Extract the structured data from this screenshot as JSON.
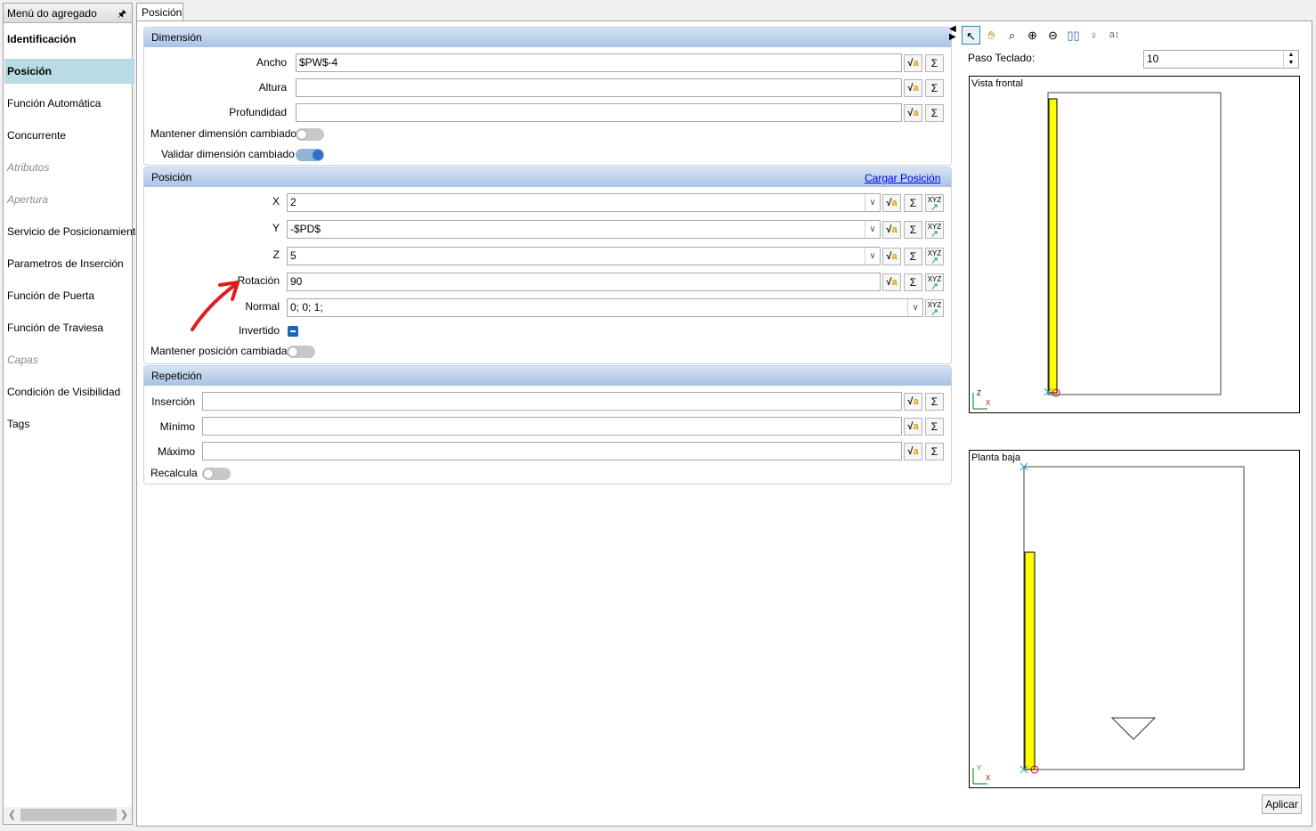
{
  "menu": {
    "title": "Menú do agregado",
    "items": [
      {
        "label": "Identificación"
      },
      {
        "label": "Posición"
      },
      {
        "label": "Función Automática"
      },
      {
        "label": "Concurrente"
      },
      {
        "label": "Atributos"
      },
      {
        "label": "Apertura"
      },
      {
        "label": "Servicio de Posicionamiento"
      },
      {
        "label": "Parametros de Inserción"
      },
      {
        "label": "Función de Puerta"
      },
      {
        "label": "Función de Traviesa"
      },
      {
        "label": "Capas"
      },
      {
        "label": "Condición de Visibilidad"
      },
      {
        "label": "Tags"
      }
    ]
  },
  "tab": {
    "label": "Posición"
  },
  "dimension": {
    "title": "Dimensión",
    "ancho": {
      "label": "Ancho",
      "value": "$PW$-4"
    },
    "altura": {
      "label": "Altura",
      "value": ""
    },
    "profundidad": {
      "label": "Profundidad",
      "value": ""
    },
    "mantener_label": "Mantener dimensión cambiado",
    "mantener_on": false,
    "validar_label": "Validar dimensión cambiado",
    "validar_on": true
  },
  "posicion": {
    "title": "Posición",
    "cargar_link": "Cargar Posición",
    "x": {
      "label": "X",
      "value": "2"
    },
    "y": {
      "label": "Y",
      "value": "-$PD$"
    },
    "z": {
      "label": "Z",
      "value": "5"
    },
    "rotacion": {
      "label": "Rotación",
      "value": "90"
    },
    "normal": {
      "label": "Normal",
      "value": "0; 0; 1;"
    },
    "invertido_label": "Invertido",
    "invertido_checked": true,
    "mantener_label": "Mantener posición cambiada",
    "mantener_on": false
  },
  "repeticion": {
    "title": "Repetición",
    "insercion": {
      "label": "Inserción",
      "value": ""
    },
    "minimo": {
      "label": "Mínimo",
      "value": ""
    },
    "maximo": {
      "label": "Máximo",
      "value": ""
    },
    "recalcula_label": "Recalcula",
    "recalcula_on": false
  },
  "buttons": {
    "sigma": "Σ",
    "xyz": "XYZ"
  },
  "preview": {
    "paso_label": "Paso Teclado:",
    "paso_value": "10",
    "front_title": "Vista frontal",
    "plan_title": "Planta baja",
    "axis_z": "Z",
    "axis_x": "X",
    "axis_y": "Y",
    "apply_label": "Aplicar",
    "toolbar_icons": [
      "pointer-icon",
      "pan-icon",
      "zoom-icon",
      "zoom-in-icon",
      "zoom-out-icon",
      "zoom-extents-icon",
      "person-icon",
      "text-icon"
    ]
  },
  "colors": {
    "selection": "#b8dbe6",
    "panel_header": "#a9c2e4",
    "piece": "#ffff00",
    "annotation_arrow": "#e11b1b"
  }
}
